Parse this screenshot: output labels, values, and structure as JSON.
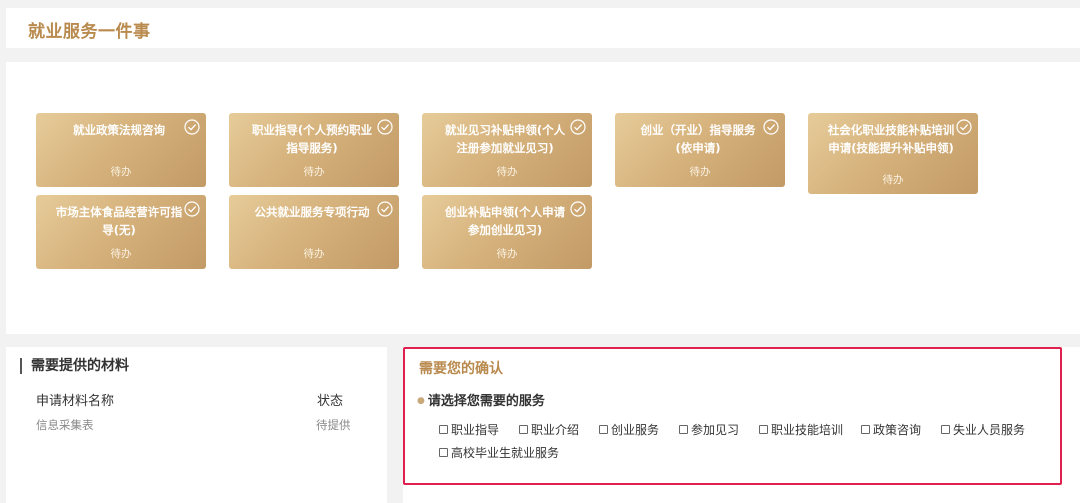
{
  "header": {
    "title": "就业服务一件事"
  },
  "cards": [
    {
      "label": "就业政策法规咨询",
      "status": "待办"
    },
    {
      "label": "职业指导(个人预约职业指导服务)",
      "status": "待办"
    },
    {
      "label": "就业见习补贴申领(个人注册参加就业见习)",
      "status": "待办"
    },
    {
      "label": "创业（开业）指导服务(依申请)",
      "status": "待办"
    },
    {
      "label": "社会化职业技能补贴培训申请(技能提升补贴申领)",
      "status": "待办"
    },
    {
      "label": "市场主体食品经营许可指导(无)",
      "status": "待办"
    },
    {
      "label": "公共就业服务专项行动",
      "status": "待办"
    },
    {
      "label": "创业补贴申领(个人申请参加创业见习)",
      "status": "待办"
    }
  ],
  "materials": {
    "title": "需要提供的材料",
    "col_name": "申请材料名称",
    "col_status": "状态",
    "rows": [
      {
        "name": "信息采集表",
        "status": "待提供"
      }
    ]
  },
  "confirm": {
    "title": "需要您的确认",
    "question": "请选择您需要的服务",
    "options": [
      "职业指导",
      "职业介绍",
      "创业服务",
      "参加见习",
      "职业技能培训",
      "政策咨询",
      "失业人员服务",
      "高校毕业生就业服务"
    ]
  },
  "colors": {
    "accent": "#b98a4e",
    "highlight_border": "#e0204f",
    "card_gold": "#d6b27c"
  },
  "icons": {
    "card_check": "check-circle-icon",
    "option_box": "checkbox-icon"
  }
}
